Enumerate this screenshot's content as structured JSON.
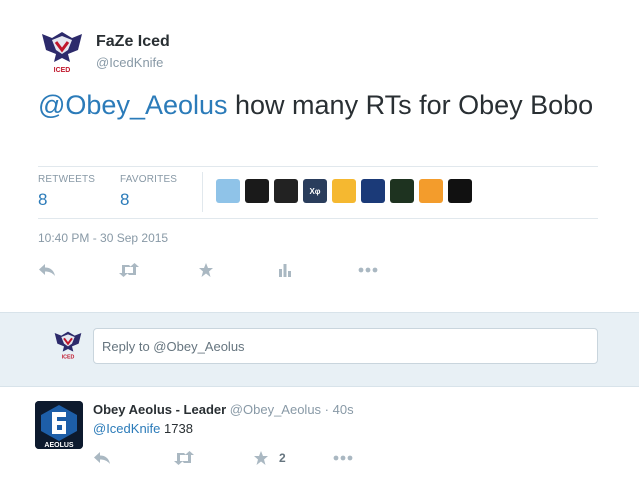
{
  "tweet": {
    "author_name": "FaZe Iced",
    "author_handle": "@IcedKnife",
    "text_mention": "@Obey_Aeolus",
    "text_rest": " how many RTs for Obey Bobo",
    "retweets_label": "RETWEETS",
    "retweets_count": "8",
    "favorites_label": "FAVORITES",
    "favorites_count": "8",
    "timestamp": "10:40 PM - 30 Sep 2015",
    "avatar_text": "ICED"
  },
  "faces": [
    {
      "name": "avatar-face-1",
      "color": "#8fc3e8",
      "text": ""
    },
    {
      "name": "avatar-face-2",
      "color": "#1a1a1a",
      "text": ""
    },
    {
      "name": "avatar-face-3",
      "color": "#222222",
      "text": ""
    },
    {
      "name": "avatar-face-4",
      "color": "#2a3d5c",
      "text": "Xφ"
    },
    {
      "name": "avatar-face-5",
      "color": "#f5b830",
      "text": ""
    },
    {
      "name": "avatar-face-6",
      "color": "#1b3a78",
      "text": ""
    },
    {
      "name": "avatar-face-7",
      "color": "#1e3320",
      "text": ""
    },
    {
      "name": "avatar-face-8",
      "color": "#f39c2c",
      "text": ""
    },
    {
      "name": "avatar-face-9",
      "color": "#111111",
      "text": ""
    }
  ],
  "reply_box": {
    "placeholder": "Reply to @Obey_Aeolus"
  },
  "reply_tweet": {
    "name": "Obey Aeolus - Leader",
    "handle": "@Obey_Aeolus",
    "time": "· 40s",
    "mention": "@IcedKnife",
    "text": " 1738",
    "favorite_count": "2",
    "avatar_text": "AEOLUS"
  },
  "colors": {
    "link": "#2b7bb9",
    "muted": "#8899a6",
    "reply_bg": "#e8f0f5"
  }
}
